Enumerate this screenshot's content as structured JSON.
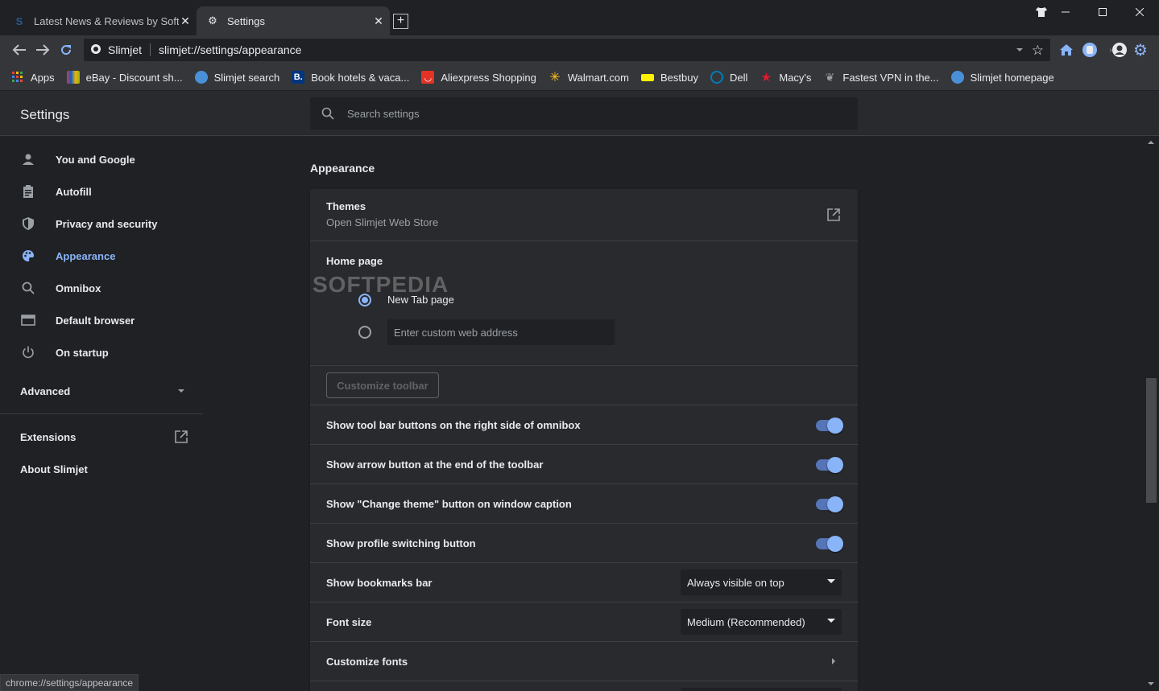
{
  "tabs": [
    {
      "title": "Latest News & Reviews by Softpedia"
    },
    {
      "title": "Settings"
    }
  ],
  "toolbar": {
    "site_name": "Slimjet",
    "url": "slimjet://settings/appearance"
  },
  "bookmarks": [
    {
      "label": "Apps",
      "icon": "apps-grid-icon",
      "color": "#ea4335"
    },
    {
      "label": "eBay - Discount sh...",
      "icon": "ebay-icon",
      "color": "#e53238"
    },
    {
      "label": "Slimjet search",
      "icon": "slimjet-icon",
      "color": "#4a90d9"
    },
    {
      "label": "Book hotels & vaca...",
      "icon": "booking-icon",
      "color": "#003580"
    },
    {
      "label": "Aliexpress Shopping",
      "icon": "aliexpress-icon",
      "color": "#e43225"
    },
    {
      "label": "Walmart.com",
      "icon": "walmart-icon",
      "color": "#ffc220"
    },
    {
      "label": "Bestbuy",
      "icon": "bestbuy-icon",
      "color": "#fff200"
    },
    {
      "label": "Dell",
      "icon": "dell-icon",
      "color": "#007db8"
    },
    {
      "label": "Macy's",
      "icon": "macys-star-icon",
      "color": "#e21a2c"
    },
    {
      "label": "Fastest VPN in the...",
      "icon": "vpn-icon",
      "color": "#9aa0a6"
    },
    {
      "label": "Slimjet homepage",
      "icon": "slimjet-icon",
      "color": "#4a90d9"
    }
  ],
  "settings": {
    "title": "Settings",
    "search_placeholder": "Search settings"
  },
  "sidebar": {
    "items": [
      {
        "label": "You and Google",
        "icon": "person-icon"
      },
      {
        "label": "Autofill",
        "icon": "clipboard-icon"
      },
      {
        "label": "Privacy and security",
        "icon": "shield-icon"
      },
      {
        "label": "Appearance",
        "icon": "palette-icon"
      },
      {
        "label": "Omnibox",
        "icon": "search-icon"
      },
      {
        "label": "Default browser",
        "icon": "browser-icon"
      },
      {
        "label": "On startup",
        "icon": "power-icon"
      }
    ],
    "advanced": "Advanced",
    "extensions": "Extensions",
    "about": "About Slimjet"
  },
  "appearance": {
    "section_title": "Appearance",
    "themes_label": "Themes",
    "themes_sub": "Open Slimjet Web Store",
    "home_page_label": "Home page",
    "new_tab_label": "New Tab page",
    "custom_address_placeholder": "Enter custom web address",
    "customize_toolbar": "Customize toolbar",
    "toggles": [
      {
        "label": "Show tool bar buttons on the right side of omnibox",
        "on": true
      },
      {
        "label": "Show arrow button at the end of the toolbar",
        "on": true
      },
      {
        "label": "Show \"Change theme\" button on window caption",
        "on": true
      },
      {
        "label": "Show profile switching button",
        "on": true
      }
    ],
    "bookmarks_bar_label": "Show bookmarks bar",
    "bookmarks_bar_value": "Always visible on top",
    "font_size_label": "Font size",
    "font_size_value": "Medium (Recommended)",
    "customize_fonts_label": "Customize fonts"
  },
  "watermark": "SOFTPEDIA",
  "status_url": "chrome://settings/appearance",
  "colors": {
    "accent": "#8ab4f8",
    "background": "#202124",
    "card": "#292a2d"
  }
}
